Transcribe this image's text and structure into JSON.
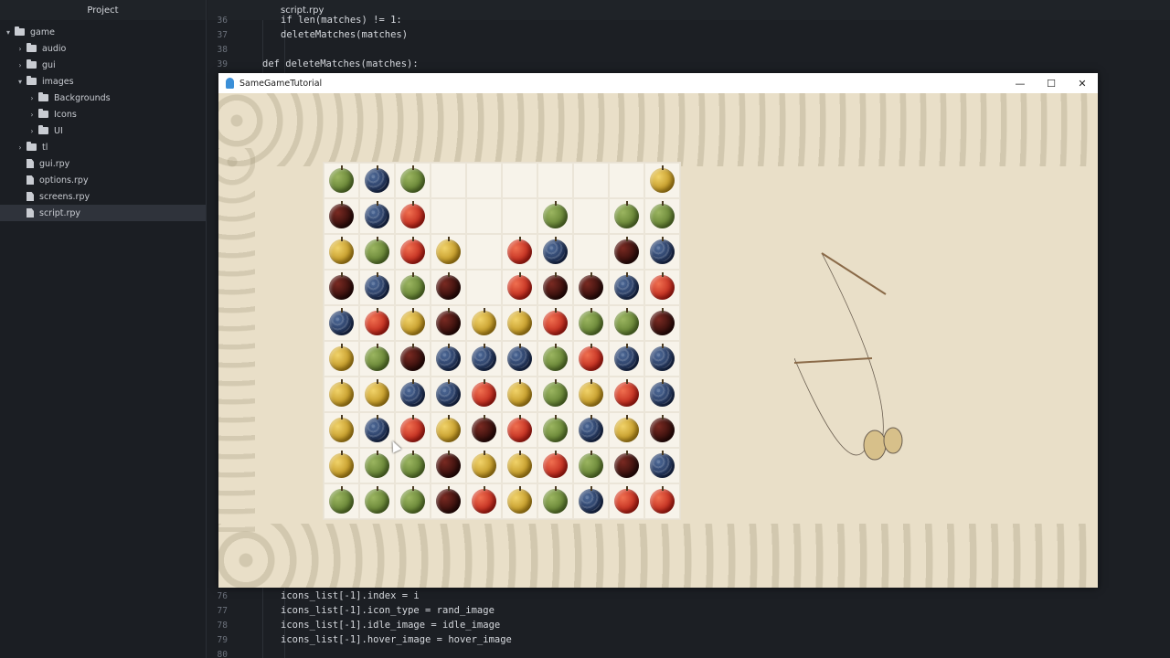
{
  "sidebar": {
    "title": "Project",
    "items": [
      {
        "label": "game",
        "type": "folder",
        "level": 0,
        "expanded": true
      },
      {
        "label": "audio",
        "type": "folder",
        "level": 1,
        "expanded": false
      },
      {
        "label": "gui",
        "type": "folder",
        "level": 1,
        "expanded": false
      },
      {
        "label": "images",
        "type": "folder",
        "level": 1,
        "expanded": true
      },
      {
        "label": "Backgrounds",
        "type": "folder",
        "level": 2,
        "expanded": false
      },
      {
        "label": "Icons",
        "type": "folder",
        "level": 2,
        "expanded": false
      },
      {
        "label": "UI",
        "type": "folder",
        "level": 2,
        "expanded": false
      },
      {
        "label": "tl",
        "type": "folder",
        "level": 1,
        "expanded": false
      },
      {
        "label": "gui.rpy",
        "type": "file",
        "level": 1
      },
      {
        "label": "options.rpy",
        "type": "file",
        "level": 1
      },
      {
        "label": "screens.rpy",
        "type": "file",
        "level": 1
      },
      {
        "label": "script.rpy",
        "type": "file",
        "level": 1,
        "selected": true
      }
    ]
  },
  "editor": {
    "tab": "script.rpy",
    "lines": [
      {
        "n": "36",
        "text": "if len(matches) != 1:"
      },
      {
        "n": "37",
        "text": "    deleteMatches(matches)"
      },
      {
        "n": "38",
        "text": ""
      },
      {
        "n": "39",
        "text": "def deleteMatches(matches):"
      },
      {
        "n": "76",
        "text": "    icons_list[-1].index = i"
      },
      {
        "n": "77",
        "text": "    icons_list[-1].icon_type = rand_image"
      },
      {
        "n": "78",
        "text": "    icons_list[-1].idle_image = idle_image"
      },
      {
        "n": "79",
        "text": "    icons_list[-1].hover_image = hover_image"
      },
      {
        "n": "80",
        "text": ""
      }
    ]
  },
  "game_window": {
    "title": "SameGameTutorial",
    "minimize": "—",
    "maximize": "☐",
    "close": "✕",
    "board": [
      [
        "green",
        "blue",
        "green",
        "",
        "",
        "",
        "",
        "",
        "",
        "yellow"
      ],
      [
        "dark",
        "blue",
        "red",
        "",
        "",
        "",
        "green",
        "",
        "green",
        "green"
      ],
      [
        "yellow",
        "green",
        "red",
        "yellow",
        "",
        "red",
        "blue",
        "",
        "dark",
        "blue"
      ],
      [
        "dark",
        "blue",
        "green",
        "dark",
        "",
        "red",
        "dark",
        "dark",
        "blue",
        "red"
      ],
      [
        "blue",
        "red",
        "yellow",
        "dark",
        "yellow",
        "yellow",
        "red",
        "green",
        "green",
        "dark"
      ],
      [
        "yellow",
        "green",
        "dark",
        "blue",
        "blue",
        "blue",
        "green",
        "red",
        "blue",
        "blue"
      ],
      [
        "yellow",
        "yellow",
        "blue",
        "blue",
        "red",
        "yellow",
        "green",
        "yellow",
        "red",
        "blue"
      ],
      [
        "yellow",
        "blue",
        "red",
        "yellow",
        "dark",
        "red",
        "green",
        "blue",
        "yellow",
        "dark"
      ],
      [
        "yellow",
        "green",
        "green",
        "dark",
        "yellow",
        "yellow",
        "red",
        "green",
        "dark",
        "blue"
      ],
      [
        "green",
        "green",
        "green",
        "dark",
        "red",
        "yellow",
        "green",
        "blue",
        "red",
        "red"
      ]
    ]
  }
}
